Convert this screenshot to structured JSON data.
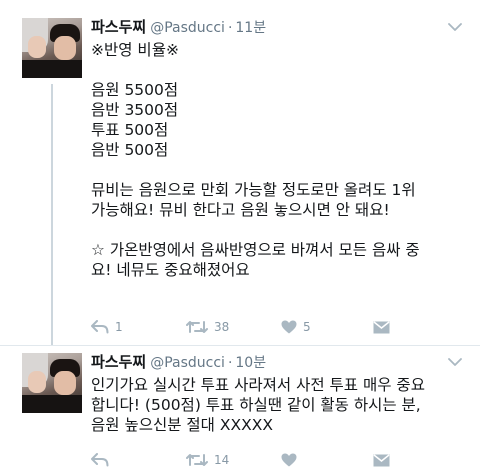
{
  "tweets": [
    {
      "name": "파스두찌",
      "handle": "@Pasducci",
      "separator": "·",
      "time": "11분",
      "lines": [
        "※반영 비율※",
        "",
        "음원 5500점",
        "음반 3500점",
        "투표 500점",
        "음반 500점",
        "",
        "뮤비는 음원으로 만회 가능할 정도로만 올려도 1위",
        "가능해요! 뮤비 한다고 음원 놓으시면 안 돼요!",
        "",
        "☆ 가온반영에서 음싸반영으로 바껴서 모든 음싸 중",
        "요! 네뮤도 중요해졌어요"
      ],
      "reply_count": "1",
      "retweet_count": "38",
      "like_count": "5",
      "icons": {
        "reply": "reply-icon",
        "retweet": "retweet-icon",
        "like": "heart-icon",
        "dm": "direct-message-icon"
      }
    },
    {
      "name": "파스두찌",
      "handle": "@Pasducci",
      "separator": "·",
      "time": "10분",
      "lines": [
        "인기가요 실시간 투표 사라져서 사전 투표 매우 중요",
        "합니다! (500점) 투표 하실땐 같이 활동 하시는 분,",
        "음원 높으신분 절대 XXXXX"
      ],
      "reply_count": "",
      "retweet_count": "14",
      "like_count": "",
      "icons": {
        "reply": "reply-icon",
        "retweet": "retweet-icon",
        "like": "heart-icon",
        "dm": "direct-message-icon"
      }
    }
  ],
  "colors": {
    "text": "#14171a",
    "secondary": "#657786",
    "action_icon": "#aab8c2",
    "divider": "#e1e8ed"
  }
}
